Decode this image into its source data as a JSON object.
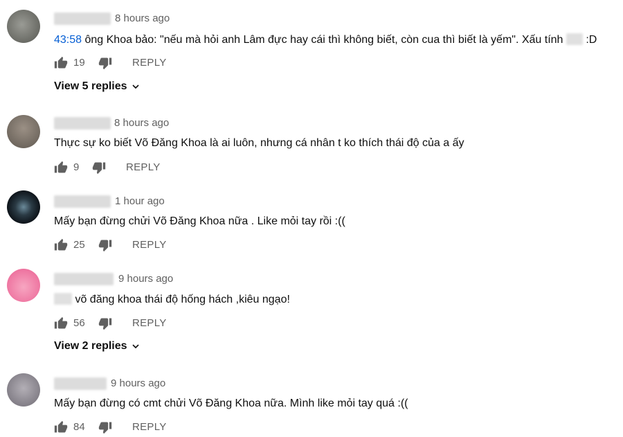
{
  "comments": [
    {
      "time": "8 hours ago",
      "timestamp_link": "43:58",
      "text": " ông Khoa bảo: \"nếu mà hỏi anh Lâm đực hay cái thì không biết, còn cua thì biết là yếm\". Xấu tính ",
      "text_end": " :D",
      "likes": "19",
      "reply_label": "REPLY",
      "view_replies": "View 5 replies",
      "avatar_color": "#6d6f6a"
    },
    {
      "time": "8 hours ago",
      "text": "Thực sự ko biết Võ Đăng Khoa là ai luôn, nhưng cá nhân t ko thích thái độ của a ấy",
      "likes": "9",
      "reply_label": "REPLY",
      "avatar_color": "#7a7268"
    },
    {
      "time": "1 hour ago",
      "text": "Mấy bạn đừng chửi Võ Đăng Khoa nữa . Like mỏi tay rồi :((",
      "likes": "25",
      "reply_label": "REPLY",
      "avatar_color": "#1c2730"
    },
    {
      "time": "9 hours ago",
      "text": " võ đăng khoa thái độ hống hách ,kiêu ngạo!",
      "likes": "56",
      "reply_label": "REPLY",
      "view_replies": "View 2 replies",
      "avatar_color": "#f27fa6"
    },
    {
      "time": "9 hours ago",
      "text": "Mấy bạn đừng có cmt chửi Võ Đăng Khoa nữa. Mình like mỏi tay quá :((",
      "likes": "84",
      "reply_label": "REPLY",
      "avatar_color": "#8e8a94"
    }
  ]
}
